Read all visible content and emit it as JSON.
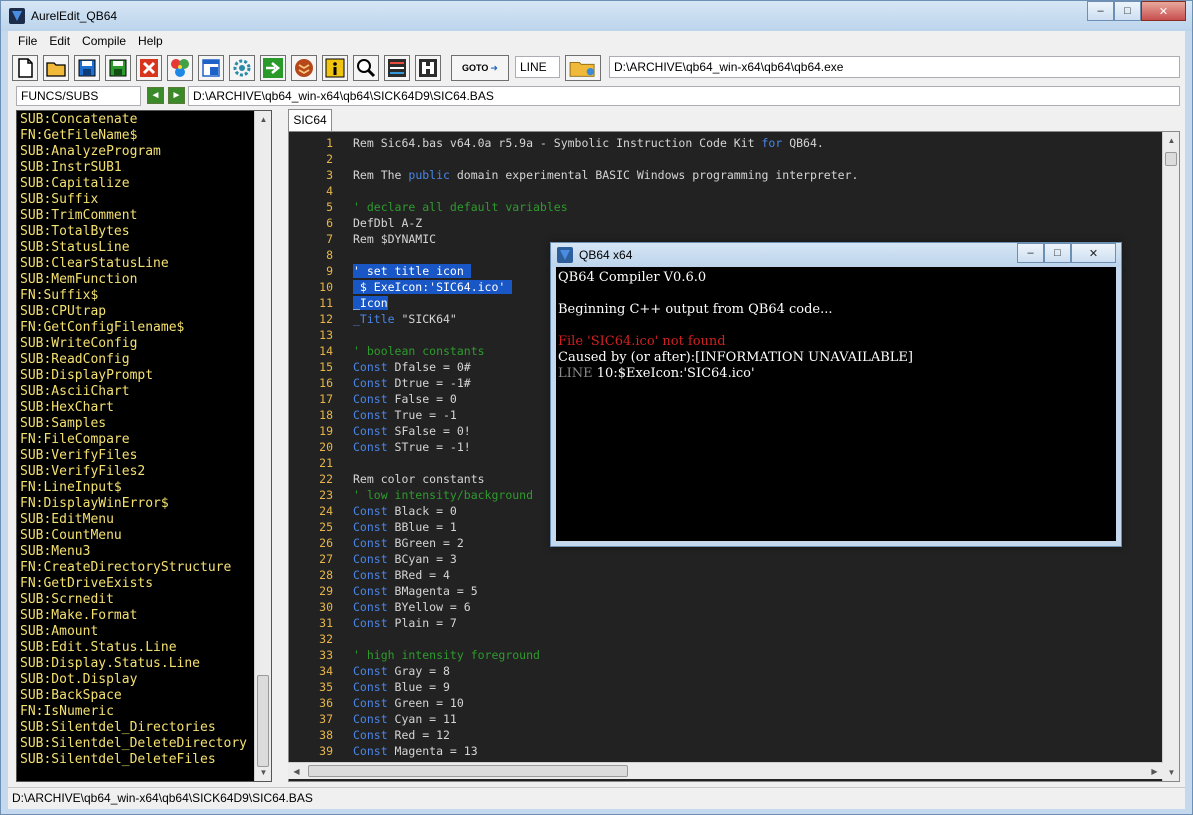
{
  "window": {
    "title": "AurelEdit_QB64"
  },
  "menu": [
    "File",
    "Edit",
    "Compile",
    "Help"
  ],
  "toolbar": {
    "buttons": [
      "new-file",
      "open-folder",
      "save",
      "save-all",
      "delete",
      "color-picker",
      "export",
      "settings",
      "run",
      "build",
      "info",
      "search",
      "list",
      "format"
    ],
    "goto_label": "GOTO",
    "line_label": "LINE",
    "exe_path": "D:\\ARCHIVE\\qb64_win-x64\\qb64\\qb64.exe"
  },
  "funcs": {
    "dropdown": "FUNCS/SUBS",
    "prev_button": "◄",
    "next_button": "►",
    "bas_path": "D:\\ARCHIVE\\qb64_win-x64\\qb64\\SICK64D9\\SIC64.BAS",
    "items": [
      "SUB:Concatenate",
      "FN:GetFileName$",
      "SUB:AnalyzeProgram",
      "SUB:InstrSUB1",
      "SUB:Capitalize",
      "SUB:Suffix",
      "SUB:TrimComment",
      "SUB:TotalBytes",
      "SUB:StatusLine",
      "SUB:ClearStatusLine",
      "SUB:MemFunction",
      "FN:Suffix$",
      "SUB:CPUtrap",
      "FN:GetConfigFilename$",
      "SUB:WriteConfig",
      "SUB:ReadConfig",
      "SUB:DisplayPrompt",
      "SUB:AsciiChart",
      "SUB:HexChart",
      "SUB:Samples",
      "FN:FileCompare",
      "SUB:VerifyFiles",
      "SUB:VerifyFiles2",
      "FN:LineInput$",
      "FN:DisplayWinError$",
      "SUB:EditMenu",
      "SUB:CountMenu",
      "SUB:Menu3",
      "FN:CreateDirectoryStructure",
      "FN:GetDriveExists",
      "SUB:Scrnedit",
      "SUB:Make.Format",
      "SUB:Amount",
      "SUB:Edit.Status.Line",
      "SUB:Display.Status.Line",
      "SUB:Dot.Display",
      "SUB:BackSpace",
      "FN:IsNumeric",
      "SUB:Silentdel_Directories",
      "SUB:Silentdel_DeleteDirectory",
      "SUB:Silentdel_DeleteFiles"
    ]
  },
  "editor": {
    "tab": "SIC64",
    "lines": [
      {
        "n": "1",
        "segs": [
          {
            "t": "Rem Sic64.bas v64.0a r5.9a - Symbolic Instruction Code Kit ",
            "c": "st"
          },
          {
            "t": "for",
            "c": "kw"
          },
          {
            "t": " QB64.",
            "c": "st"
          }
        ]
      },
      {
        "n": "2",
        "segs": []
      },
      {
        "n": "3",
        "segs": [
          {
            "t": "Rem The ",
            "c": "st"
          },
          {
            "t": "public",
            "c": "kw"
          },
          {
            "t": " domain experimental BASIC Windows programming interpreter.",
            "c": "st"
          }
        ]
      },
      {
        "n": "4",
        "segs": []
      },
      {
        "n": "5",
        "segs": [
          {
            "t": "' declare all default variables",
            "c": "cm"
          }
        ]
      },
      {
        "n": "6",
        "segs": [
          {
            "t": "DefDbl A-Z",
            "c": "st"
          }
        ]
      },
      {
        "n": "7",
        "segs": [
          {
            "t": "Rem $DYNAMIC",
            "c": "st"
          }
        ]
      },
      {
        "n": "8",
        "segs": []
      },
      {
        "n": "9",
        "segs": [
          {
            "t": "' set title icon ",
            "c": "sel"
          }
        ]
      },
      {
        "n": "10",
        "segs": [
          {
            "t": " $ ExeIcon:'SIC64.ico' ",
            "c": "sel"
          }
        ]
      },
      {
        "n": "11",
        "segs": [
          {
            "t": "_Icon",
            "c": "sel"
          }
        ]
      },
      {
        "n": "12",
        "segs": [
          {
            "t": "_Title",
            "c": "kw"
          },
          {
            "t": " \"SICK64\"",
            "c": "st"
          }
        ]
      },
      {
        "n": "13",
        "segs": []
      },
      {
        "n": "14",
        "segs": [
          {
            "t": "' boolean constants",
            "c": "cm"
          }
        ]
      },
      {
        "n": "15",
        "segs": [
          {
            "t": "Const",
            "c": "kw"
          },
          {
            "t": " Dfalse = 0#",
            "c": "st"
          }
        ]
      },
      {
        "n": "16",
        "segs": [
          {
            "t": "Const",
            "c": "kw"
          },
          {
            "t": " Dtrue = -1#",
            "c": "st"
          }
        ]
      },
      {
        "n": "17",
        "segs": [
          {
            "t": "Const",
            "c": "kw"
          },
          {
            "t": " False = 0",
            "c": "st"
          }
        ]
      },
      {
        "n": "18",
        "segs": [
          {
            "t": "Const",
            "c": "kw"
          },
          {
            "t": " True = -1",
            "c": "st"
          }
        ]
      },
      {
        "n": "19",
        "segs": [
          {
            "t": "Const",
            "c": "kw"
          },
          {
            "t": " SFalse = 0!",
            "c": "st"
          }
        ]
      },
      {
        "n": "20",
        "segs": [
          {
            "t": "Const",
            "c": "kw"
          },
          {
            "t": " STrue = -1!",
            "c": "st"
          }
        ]
      },
      {
        "n": "21",
        "segs": []
      },
      {
        "n": "22",
        "segs": [
          {
            "t": "Rem color constants",
            "c": "st"
          }
        ]
      },
      {
        "n": "23",
        "segs": [
          {
            "t": "' low intensity/background",
            "c": "cm"
          }
        ]
      },
      {
        "n": "24",
        "segs": [
          {
            "t": "Const",
            "c": "kw"
          },
          {
            "t": " Black = 0",
            "c": "st"
          }
        ]
      },
      {
        "n": "25",
        "segs": [
          {
            "t": "Const",
            "c": "kw"
          },
          {
            "t": " BBlue = 1",
            "c": "st"
          }
        ]
      },
      {
        "n": "26",
        "segs": [
          {
            "t": "Const",
            "c": "kw"
          },
          {
            "t": " BGreen = 2",
            "c": "st"
          }
        ]
      },
      {
        "n": "27",
        "segs": [
          {
            "t": "Const",
            "c": "kw"
          },
          {
            "t": " BCyan = 3",
            "c": "st"
          }
        ]
      },
      {
        "n": "28",
        "segs": [
          {
            "t": "Const",
            "c": "kw"
          },
          {
            "t": " BRed = 4",
            "c": "st"
          }
        ]
      },
      {
        "n": "29",
        "segs": [
          {
            "t": "Const",
            "c": "kw"
          },
          {
            "t": " BMagenta = 5",
            "c": "st"
          }
        ]
      },
      {
        "n": "30",
        "segs": [
          {
            "t": "Const",
            "c": "kw"
          },
          {
            "t": " BYellow = 6",
            "c": "st"
          }
        ]
      },
      {
        "n": "31",
        "segs": [
          {
            "t": "Const",
            "c": "kw"
          },
          {
            "t": " Plain = 7",
            "c": "st"
          }
        ]
      },
      {
        "n": "32",
        "segs": []
      },
      {
        "n": "33",
        "segs": [
          {
            "t": "' high intensity foreground",
            "c": "cm"
          }
        ]
      },
      {
        "n": "34",
        "segs": [
          {
            "t": "Const",
            "c": "kw"
          },
          {
            "t": " Gray = 8",
            "c": "st"
          }
        ]
      },
      {
        "n": "35",
        "segs": [
          {
            "t": "Const",
            "c": "kw"
          },
          {
            "t": " Blue = 9",
            "c": "st"
          }
        ]
      },
      {
        "n": "36",
        "segs": [
          {
            "t": "Const",
            "c": "kw"
          },
          {
            "t": " Green = 10",
            "c": "st"
          }
        ]
      },
      {
        "n": "37",
        "segs": [
          {
            "t": "Const",
            "c": "kw"
          },
          {
            "t": " Cyan = 11",
            "c": "st"
          }
        ]
      },
      {
        "n": "38",
        "segs": [
          {
            "t": "Const",
            "c": "kw"
          },
          {
            "t": " Red = 12",
            "c": "st"
          }
        ]
      },
      {
        "n": "39",
        "segs": [
          {
            "t": "Const",
            "c": "kw"
          },
          {
            "t": " Magenta = 13",
            "c": "st"
          }
        ]
      }
    ]
  },
  "statusbar": {
    "path": "D:\\ARCHIVE\\qb64_win-x64\\qb64\\SICK64D9\\SIC64.BAS"
  },
  "compiler": {
    "title": "QB64 x64",
    "lines": [
      {
        "segs": [
          {
            "t": "QB64 Compiler V0.6.0",
            "c": "con-white"
          }
        ]
      },
      {
        "segs": []
      },
      {
        "segs": [
          {
            "t": "Beginning C++ output from QB64 code...",
            "c": "con-white"
          }
        ]
      },
      {
        "segs": []
      },
      {
        "segs": [
          {
            "t": "File 'SIC64.ico' not found",
            "c": "con-red"
          }
        ]
      },
      {
        "segs": [
          {
            "t": "Caused by (or after):[INFORMATION UNAVAILABLE]",
            "c": "con-white"
          }
        ]
      },
      {
        "segs": [
          {
            "t": "LINE ",
            "c": "con-gray"
          },
          {
            "t": "10",
            "c": "con-white"
          },
          {
            "t": ":$ExeIcon:'SIC64.ico'",
            "c": "con-white"
          }
        ]
      }
    ]
  },
  "colors": {
    "func_text": "#f4e170",
    "line_number": "#e8b648",
    "keyword": "#4a86e8",
    "comment": "#2e9b2e",
    "selection": "#1a57c6",
    "error": "#d02020"
  }
}
